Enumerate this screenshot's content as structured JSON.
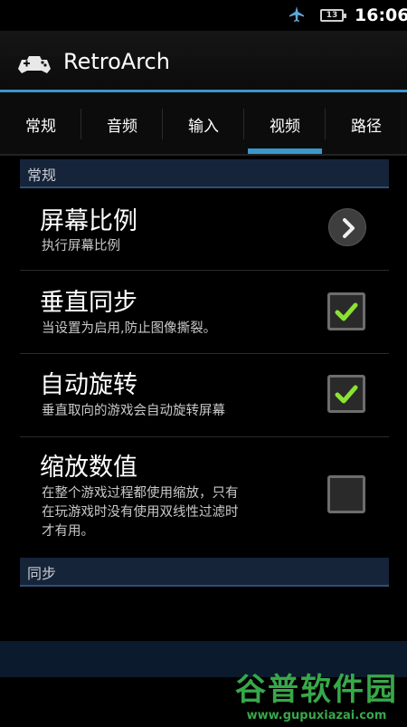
{
  "status_bar": {
    "time": "16:06",
    "battery_label": "13",
    "icons": [
      "airplane-icon",
      "battery-icon"
    ]
  },
  "action_bar": {
    "title": "RetroArch",
    "icon": "gamepad-icon"
  },
  "tabs": [
    {
      "label": "常规",
      "active": false
    },
    {
      "label": "音频",
      "active": false
    },
    {
      "label": "输入",
      "active": false
    },
    {
      "label": "视频",
      "active": true
    },
    {
      "label": "路径",
      "active": false
    }
  ],
  "sections": {
    "general_header": "常规",
    "sync_header": "同步"
  },
  "preferences": [
    {
      "title": "屏幕比例",
      "summary": "执行屏幕比例",
      "widget": "chevron-right-icon"
    },
    {
      "title": "垂直同步",
      "summary": "当设置为启用,防止图像撕裂。",
      "widget": "checkbox",
      "checked": true
    },
    {
      "title": "自动旋转",
      "summary": "垂直取向的游戏会自动旋转屏幕",
      "widget": "checkbox",
      "checked": true
    },
    {
      "title": "缩放数值",
      "summary_lines": [
        "在整个游戏过程都使用缩放，只有",
        "在玩游戏时没有使用双线性过滤时",
        "才有用。"
      ],
      "widget": "checkbox",
      "checked": false
    }
  ],
  "watermark": {
    "main": "谷普软件园",
    "url": "www.gupuxiazai.com"
  },
  "colors": {
    "accent": "#3a97c9",
    "check": "#8ae234",
    "section_bg": "#16243a",
    "watermark": "#37a84a"
  }
}
